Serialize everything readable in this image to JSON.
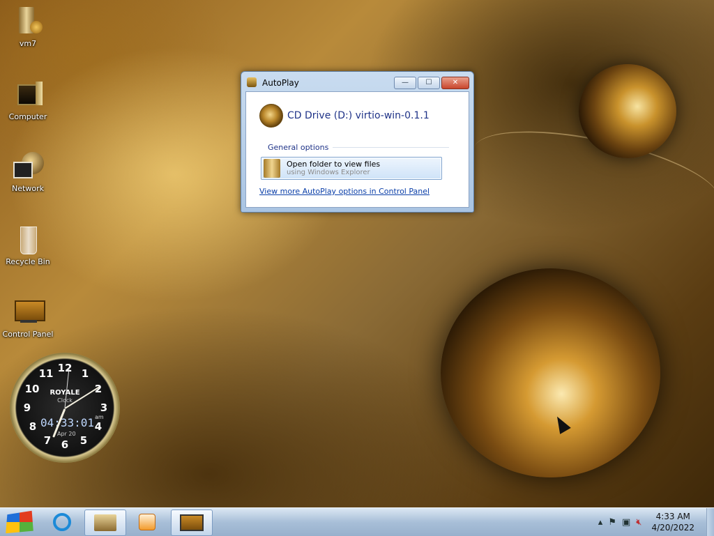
{
  "desktop": {
    "icons": [
      {
        "label": "vm7"
      },
      {
        "label": "Computer"
      },
      {
        "label": "Network"
      },
      {
        "label": "Recycle Bin"
      },
      {
        "label": "Control Panel"
      }
    ]
  },
  "autoplay": {
    "title": "AutoPlay",
    "drive_label": "CD Drive (D:) virtio-win-0.1.1",
    "section_title": "General options",
    "option": {
      "title": "Open folder to view files",
      "subtitle": "using Windows Explorer"
    },
    "control_panel_link": "View more AutoPlay options in Control Panel",
    "buttons": {
      "minimize": "—",
      "maximize": "☐",
      "close": "✕"
    }
  },
  "clock_gadget": {
    "numerals": [
      "12",
      "1",
      "2",
      "3",
      "4",
      "5",
      "6",
      "7",
      "8",
      "9",
      "10",
      "11"
    ],
    "brand": "ROYALE",
    "sub": "Clock",
    "digital_time": "04:33:01",
    "ampm": "am",
    "date": "Apr 20"
  },
  "taskbar": {
    "time": "4:33 AM",
    "date": "4/20/2022",
    "tray_icons": [
      "show-hidden-icons",
      "action-center-flag",
      "network",
      "volume-muted"
    ]
  },
  "colors": {
    "taskbar": "#a8bfd8",
    "link": "#0a3ea8",
    "heading_blue": "#1e3287"
  }
}
